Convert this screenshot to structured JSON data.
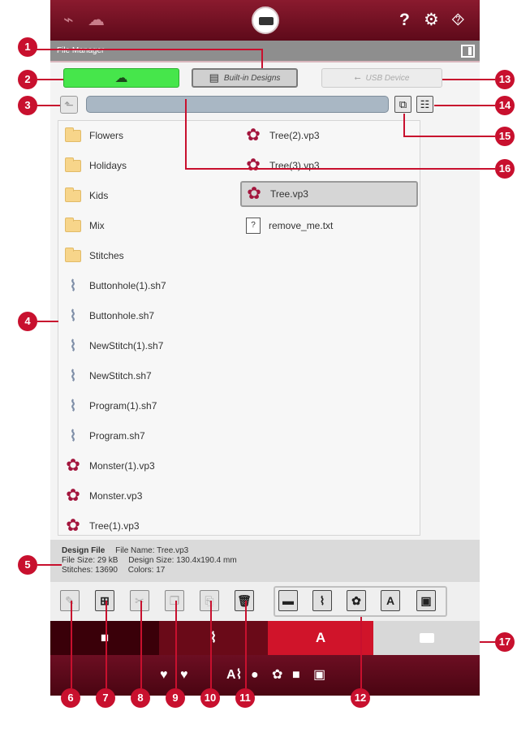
{
  "window": {
    "title": "File Manager"
  },
  "sources": {
    "cloud_icon": "cloud-icon",
    "builtin_label": "Built-in Designs",
    "usb_label": "USB Device"
  },
  "files": {
    "left": [
      "Flowers",
      "Holidays",
      "Kids",
      "Mix",
      "Stitches",
      "Buttonhole(1).sh7",
      "Buttonhole.sh7",
      "NewStitch(1).sh7",
      "NewStitch.sh7",
      "Program(1).sh7",
      "Program.sh7",
      "Monster(1).vp3",
      "Monster.vp3",
      "Tree(1).vp3"
    ],
    "right": [
      "Tree(2).vp3",
      "Tree(3).vp3",
      "Tree.vp3",
      "remove_me.txt"
    ]
  },
  "info": {
    "heading": "Design File",
    "file_name_label": "File Name:",
    "file_name": "Tree.vp3",
    "file_size_label": "File Size:",
    "file_size": "29 kB",
    "design_size_label": "Design Size:",
    "design_size": "130.4x190.4 mm",
    "stitches_label": "Stitches:",
    "stitches": "13690",
    "colors_label": "Colors:",
    "colors": "17"
  },
  "tabs": {
    "text_tab": "A"
  },
  "callouts": [
    "1",
    "2",
    "3",
    "4",
    "5",
    "6",
    "7",
    "8",
    "9",
    "10",
    "11",
    "12",
    "13",
    "14",
    "15",
    "16",
    "17"
  ],
  "colors": {
    "accent": "#c8102e",
    "header": "#6c0e22",
    "active_tab": "#d0142a",
    "cloud_active": "#46e64b"
  }
}
